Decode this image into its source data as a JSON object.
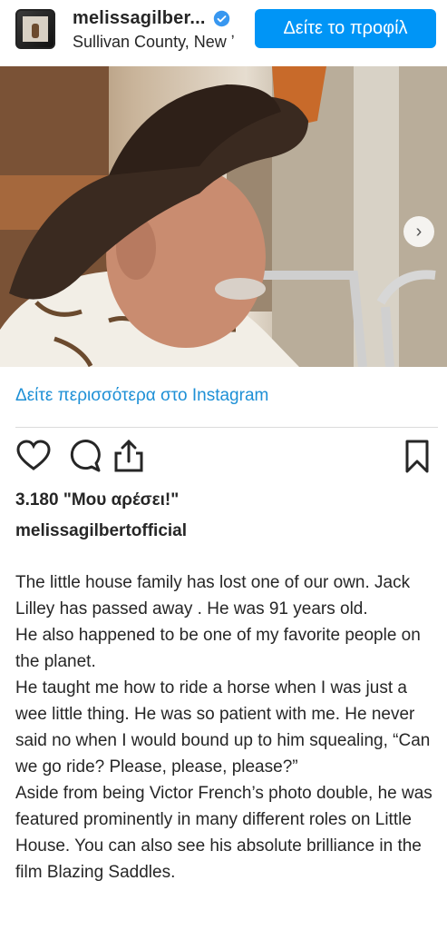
{
  "header": {
    "username": "melissagilber...",
    "location": "Sullivan County, New ʼ",
    "profile_button": "Δείτε το προφίλ"
  },
  "post": {
    "more_link": "Δείτε περισσότερα στο Instagram",
    "likes": "3.180 \"Μου αρέσει!\"",
    "username": "melissagilbertofficial",
    "caption_lines": [
      "The little house family has lost one of our own. Jack Lilley has passed away . He was 91 years old.",
      "He also happened to be one of my favorite people on the planet.",
      "He taught me how to ride a horse when I was just a wee little thing. He was so patient with me. He never said no when I would bound up to him squealing, “Can we go ride? Please, please, please?”",
      "Aside from being Victor French’s photo double, he was featured prominently in many different roles on Little House. You can also see his absolute brilliance in the film Blazing Saddles."
    ]
  },
  "icons": {
    "verified": "verified-badge-icon",
    "like": "heart-icon",
    "comment": "comment-icon",
    "share": "share-icon",
    "save": "bookmark-icon",
    "next": "chevron-right-icon"
  },
  "colors": {
    "accent": "#0095f6",
    "link": "#1e90d6",
    "text": "#262626"
  }
}
